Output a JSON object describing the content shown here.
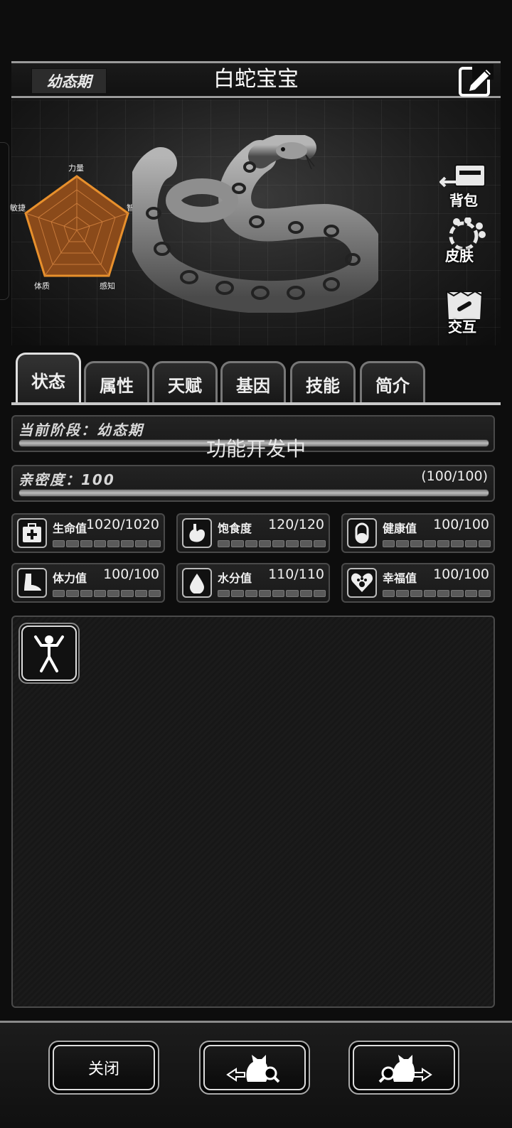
{
  "header": {
    "stage_chip": "幼态期",
    "pet_name": "白蛇宝宝"
  },
  "radar": {
    "labels": {
      "strength": "力量",
      "intelligence": "智力",
      "perception": "感知",
      "constitution": "体质",
      "agility": "敏捷"
    }
  },
  "side_buttons": {
    "backpack": "背包",
    "skin": "皮肤",
    "interact": "交互"
  },
  "tabs": [
    "状态",
    "属性",
    "天赋",
    "基因",
    "技能",
    "简介"
  ],
  "active_tab": "状态",
  "current_stage": {
    "title": "当前阶段：幼态期",
    "overlay": "功能开发中"
  },
  "intimacy": {
    "title": "亲密度：100",
    "value": "(100/100)",
    "fraction": 1.0
  },
  "stats": [
    {
      "label": "生命值",
      "value": "1020/1020",
      "icon": "medkit-icon"
    },
    {
      "label": "饱食度",
      "value": "120/120",
      "icon": "stomach-icon"
    },
    {
      "label": "健康值",
      "value": "100/100",
      "icon": "capsule-icon"
    },
    {
      "label": "体力值",
      "value": "100/100",
      "icon": "foot-icon"
    },
    {
      "label": "水分值",
      "value": "110/110",
      "icon": "water-drop-icon"
    },
    {
      "label": "幸福值",
      "value": "100/100",
      "icon": "heart-paw-icon"
    }
  ],
  "footer": {
    "close_label": "关闭"
  },
  "colors": {
    "radar_fill": "#8a4a1a",
    "radar_stroke": "#e8902c",
    "background": "#0d0d0d"
  }
}
